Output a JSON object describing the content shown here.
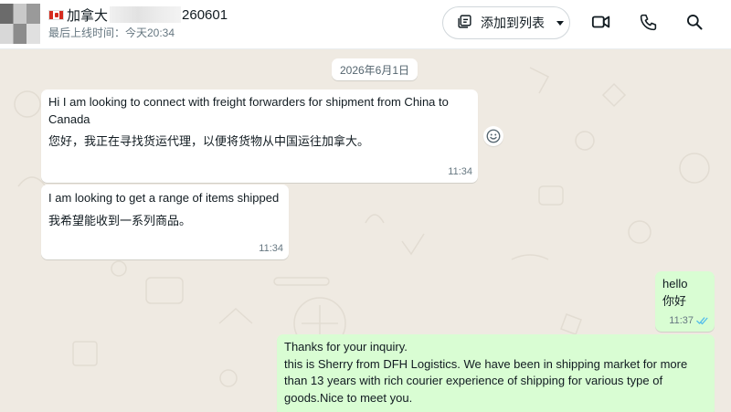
{
  "header": {
    "title_prefix": "加拿大",
    "title_suffix": "260601",
    "last_seen": "最后上线时间：今天20:34",
    "add_to_list_label": "添加到列表"
  },
  "chat": {
    "date_chip": "2026年6月1日",
    "messages": [
      {
        "direction": "incoming",
        "text_en": "Hi I am looking to connect with freight forwarders for shipment from China to Canada",
        "text_zh": "您好，我正在寻找货运代理，以便将货物从中国运往加拿大。",
        "time": "11:34"
      },
      {
        "direction": "incoming",
        "text_en": "I am looking to get a range of items shipped",
        "text_zh": "我希望能收到一系列商品。",
        "time": "11:34"
      },
      {
        "direction": "outgoing",
        "text_en": "hello",
        "text_zh": "你好",
        "time": "11:37",
        "status": "read"
      },
      {
        "direction": "outgoing",
        "text_line1": "Thanks for your inquiry.",
        "text_line2": "this is Sherry from DFH Logistics. We have been in shipping market for more than 13 years with rich courier experience of shipping for various type of goods.Nice to meet you."
      }
    ]
  },
  "icons": {
    "flag": "canada-flag-icon",
    "add_list": "list-add-icon",
    "caret": "caret-down-icon",
    "video": "video-camera-icon",
    "call": "phone-icon",
    "search": "search-icon",
    "emoji": "emoji-icon",
    "read_ticks": "double-check-icon"
  },
  "colors": {
    "header_bg": "#ffffff",
    "chat_bg": "#efeae2",
    "incoming_bubble": "#ffffff",
    "outgoing_bubble": "#d9fdd3",
    "read_tick": "#53bdeb"
  }
}
